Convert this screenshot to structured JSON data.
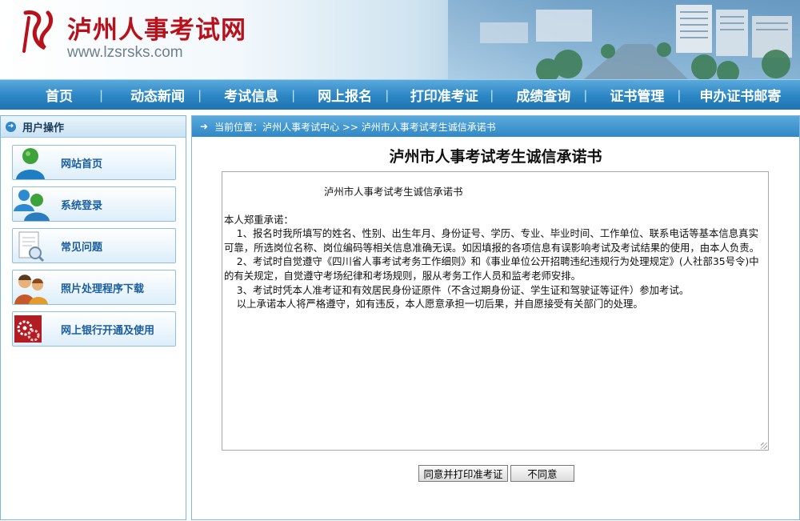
{
  "header": {
    "site_name": "泸州人事考试网",
    "site_url": "www.lzsrsks.com"
  },
  "nav": {
    "items": [
      "首页",
      "动态新闻",
      "考试信息",
      "网上报名",
      "打印准考证",
      "成绩查询",
      "证书管理",
      "申办证书邮寄"
    ],
    "separator": "|"
  },
  "sidebar": {
    "title": "用户操作",
    "items": [
      {
        "label": "网站首页",
        "icon": "user-icon"
      },
      {
        "label": "系统登录",
        "icon": "users-icon"
      },
      {
        "label": "常见问题",
        "icon": "document-search-icon"
      },
      {
        "label": "照片处理程序下载",
        "icon": "people-icon"
      },
      {
        "label": "网上银行开通及使用",
        "icon": "gears-icon"
      }
    ]
  },
  "breadcrumb": {
    "text": "当前位置：泸州人事考试中心 >> 泸州市人事考试考生诚信承诺书"
  },
  "page": {
    "title": "泸州市人事考试考生诚信承诺书",
    "letter_heading": "泸州市人事考试考生诚信承诺书",
    "letter_lines": [
      "本人郑重承诺：",
      "    1、报名时我所填写的姓名、性别、出生年月、身份证号、学历、专业、毕业时间、工作单位、联系电话等基本信息真实可靠，所选岗位名称、岗位编码等相关信息准确无误。如因填报的各项信息有误影响考试及考试结果的使用，由本人负责。",
      "    2、考试时自觉遵守《四川省人事考试考务工作细则》和《事业单位公开招聘违纪违规行为处理规定》(人社部35号令)中的有关规定，自觉遵守考场纪律和考场规则，服从考务工作人员和监考老师安排。",
      "    3、考试时凭本人准考证和有效居民身份证原件（不含过期身份证、学生证和驾驶证等证件）参加考试。",
      "    以上承诺本人将严格遵守，如有违反，本人愿意承担一切后果，并自愿接受有关部门的处理。"
    ],
    "agree_button": "同意并打印准考证",
    "disagree_button": "不同意"
  },
  "colors": {
    "brand_red": "#b7121b",
    "nav_blue": "#2c86c4",
    "link_blue": "#1a5e9e"
  }
}
